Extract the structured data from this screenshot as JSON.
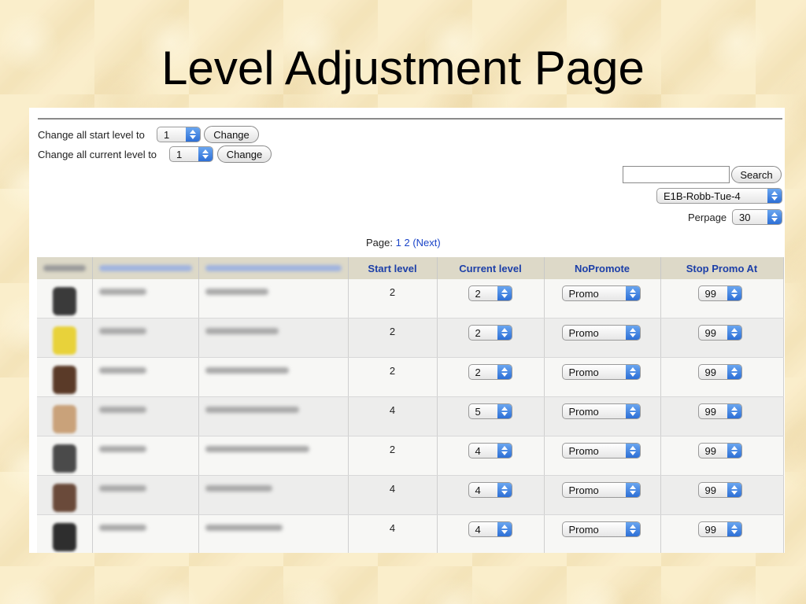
{
  "slide": {
    "title": "Level Adjustment Page"
  },
  "controls": {
    "start_level": {
      "label": "Change all start level to",
      "value": "1",
      "button": "Change"
    },
    "current_level": {
      "label": "Change all current level to",
      "value": "1",
      "button": "Change"
    },
    "search": {
      "value": "",
      "button": "Search"
    },
    "class_select": {
      "value": "E1B-Robb-Tue-4"
    },
    "perpage": {
      "label": "Perpage",
      "value": "30"
    }
  },
  "pager": {
    "label": "Page:",
    "current": "1",
    "next_page": "2",
    "next": "(Next)"
  },
  "table": {
    "columns": [
      "Image",
      "Username",
      "Fullname",
      "Start level",
      "Current level",
      "NoPromote",
      "Stop Promo At"
    ],
    "rows": [
      {
        "avatar_color": "#3a3a3a",
        "start": "2",
        "current": "2",
        "nopromote": "Promo",
        "stop": "99"
      },
      {
        "avatar_color": "#e8d23a",
        "start": "2",
        "current": "2",
        "nopromote": "Promo",
        "stop": "99"
      },
      {
        "avatar_color": "#5a3a28",
        "start": "2",
        "current": "2",
        "nopromote": "Promo",
        "stop": "99"
      },
      {
        "avatar_color": "#c9a27a",
        "start": "4",
        "current": "5",
        "nopromote": "Promo",
        "stop": "99"
      },
      {
        "avatar_color": "#4a4a4a",
        "start": "2",
        "current": "4",
        "nopromote": "Promo",
        "stop": "99"
      },
      {
        "avatar_color": "#6a4a3a",
        "start": "4",
        "current": "4",
        "nopromote": "Promo",
        "stop": "99"
      },
      {
        "avatar_color": "#2e2e2e",
        "start": "4",
        "current": "4",
        "nopromote": "Promo",
        "stop": "99"
      }
    ]
  }
}
